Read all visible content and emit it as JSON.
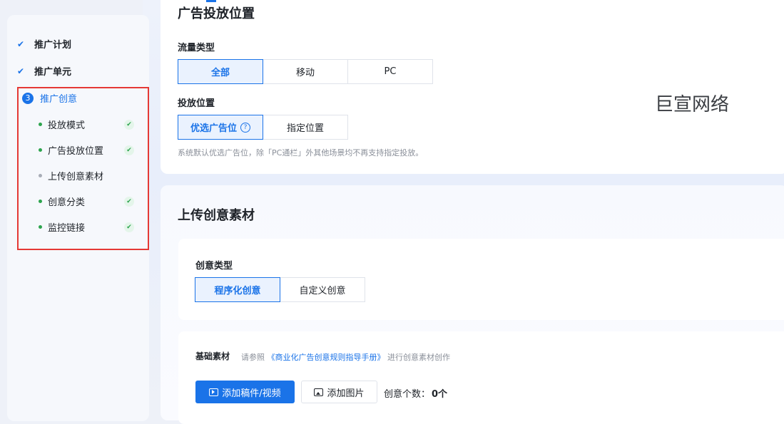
{
  "sidebar": {
    "steps": [
      {
        "label": "推广计划",
        "state": "done"
      },
      {
        "label": "推广单元",
        "state": "done"
      },
      {
        "number": "3",
        "label": "推广创意",
        "state": "active"
      }
    ],
    "sub_items": [
      {
        "label": "投放模式",
        "done": true
      },
      {
        "label": "广告投放位置",
        "done": true
      },
      {
        "label": "上传创意素材",
        "done": false
      },
      {
        "label": "创意分类",
        "done": true
      },
      {
        "label": "监控链接",
        "done": true
      }
    ]
  },
  "placement": {
    "title": "广告投放位置",
    "traffic_label": "流量类型",
    "traffic_options": [
      "全部",
      "移动",
      "PC"
    ],
    "traffic_selected": "全部",
    "position_label": "投放位置",
    "position_options": [
      "优选广告位",
      "指定位置"
    ],
    "position_selected": "优选广告位",
    "hint": "系统默认优选广告位，除「PC通栏」外其他场景均不再支持指定投放。"
  },
  "watermark": "巨宣网络",
  "upload": {
    "title": "上传创意素材",
    "creative_type_label": "创意类型",
    "creative_type_options": [
      "程序化创意",
      "自定义创意"
    ],
    "creative_type_selected": "程序化创意",
    "basic_label": "基础素材",
    "basic_hint_prefix": "请参照",
    "basic_hint_link": "《商业化广告创意规则指导手册》",
    "basic_hint_suffix": "进行创意素材创作",
    "add_video_button": "添加稿件/视频",
    "add_image_button": "添加图片",
    "count_label": "创意个数：",
    "count_value": "0个"
  },
  "colors": {
    "accent": "#1a73e8",
    "success": "#2da44e",
    "highlight_box": "#e53935"
  }
}
